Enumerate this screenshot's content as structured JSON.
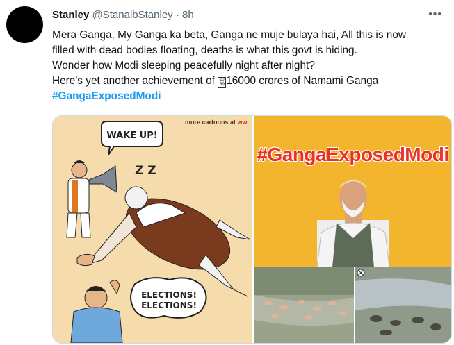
{
  "tweet": {
    "name": "Stanley",
    "handle": "@StanalbStanley",
    "separator": "·",
    "time": "8h",
    "more_icon": "ellipsis-icon",
    "lines": [
      "Mera Ganga, My Ganga ka beta, Ganga ne muje bulaya hai, All this is now",
      "filled with dead bodies floating, deaths is what this govt is hiding.",
      "Wonder how Modi sleeping peacefully night after night?"
    ],
    "line4_pre": "Here's yet another achievement of ",
    "line4_post": "16000 crores of Namami Ganga",
    "hashtag": "#GangaExposedModi"
  },
  "media": {
    "cartoon": {
      "credit_prefix": "more cartoons at ",
      "credit_suffix": "ww",
      "bubble_wake": "WAKE UP!",
      "zz": "Z Z",
      "bubble_elections": [
        "ELECTIONS!",
        "ELECTIONS!"
      ]
    },
    "poster": {
      "hashtag": "#GangaExposedModi",
      "colors": {
        "background": "#f4b52e",
        "text": "#e8312b"
      }
    }
  }
}
